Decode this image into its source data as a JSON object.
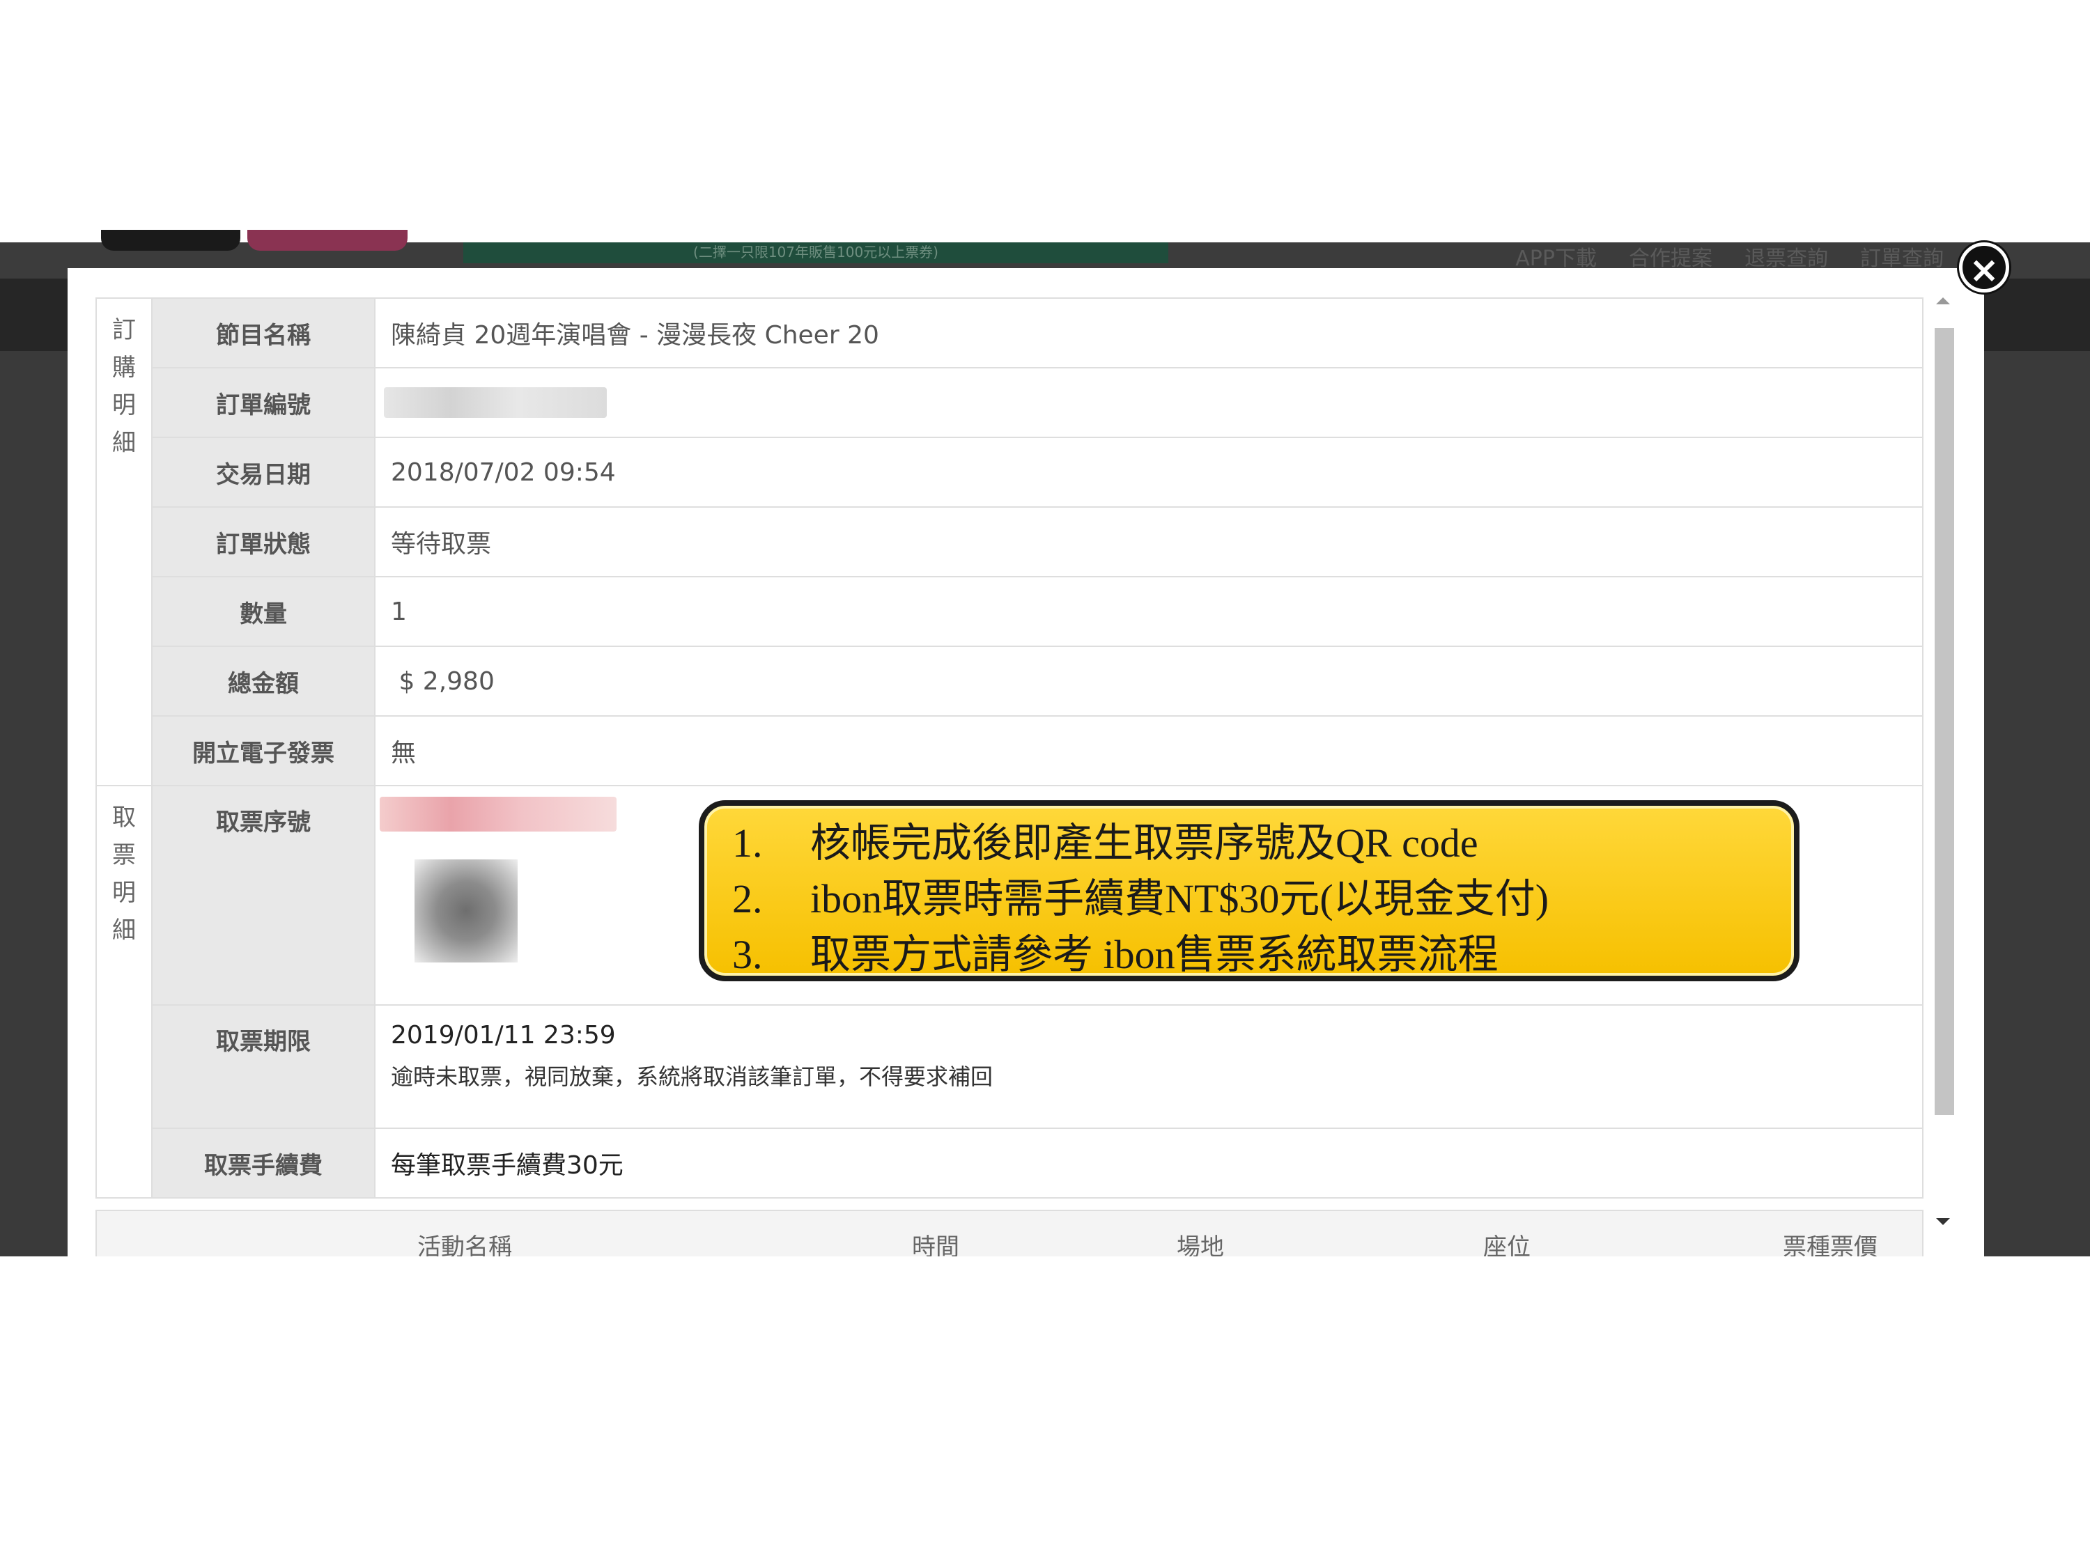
{
  "site": {
    "banner_text": "(二擇一只限107年販售100元以上票券)",
    "links": [
      "APP下載",
      "合作提案",
      "退票查詢",
      "訂單查詢"
    ]
  },
  "order_details": {
    "group_label": [
      "訂",
      "購",
      "明",
      "細"
    ],
    "rows": [
      {
        "label": "節目名稱",
        "value": "陳綺貞 20週年演唱會 - 漫漫長夜 Cheer 20"
      },
      {
        "label": "訂單編號",
        "value": ""
      },
      {
        "label": "交易日期",
        "value": "2018/07/02 09:54"
      },
      {
        "label": "訂單狀態",
        "value": "等待取票"
      },
      {
        "label": "數量",
        "value": "1"
      },
      {
        "label": "總金額",
        "value": " $ 2,980"
      },
      {
        "label": "開立電子發票",
        "value": "無"
      }
    ]
  },
  "ticket_pickup": {
    "group_label": [
      "取",
      "票",
      "明",
      "細"
    ],
    "serial_label": "取票序號",
    "deadline_label": "取票期限",
    "deadline_value": "2019/01/11 23:59",
    "deadline_note": "逾時未取票，視同放棄，系統將取消該筆訂單，不得要求補回",
    "fee_label": "取票手續費",
    "fee_value": "每筆取票手續費30元"
  },
  "callout": {
    "items": [
      {
        "num": "1.",
        "text": "核帳完成後即產生取票序號及QR code"
      },
      {
        "num": "2.",
        "text": "ibon取票時需手續費NT$30元(以現金支付)"
      },
      {
        "num": "3.",
        "text": "取票方式請參考 ibon售票系統取票流程"
      }
    ]
  },
  "lower_table": {
    "headers": [
      "活動名稱",
      "時間",
      "場地",
      "座位",
      "票種票價"
    ]
  },
  "close_symbol": "×",
  "colors": {
    "callout_fill": "#f6c000",
    "label_bg": "#e8e8e8",
    "overlay": "#3a3a3a"
  }
}
